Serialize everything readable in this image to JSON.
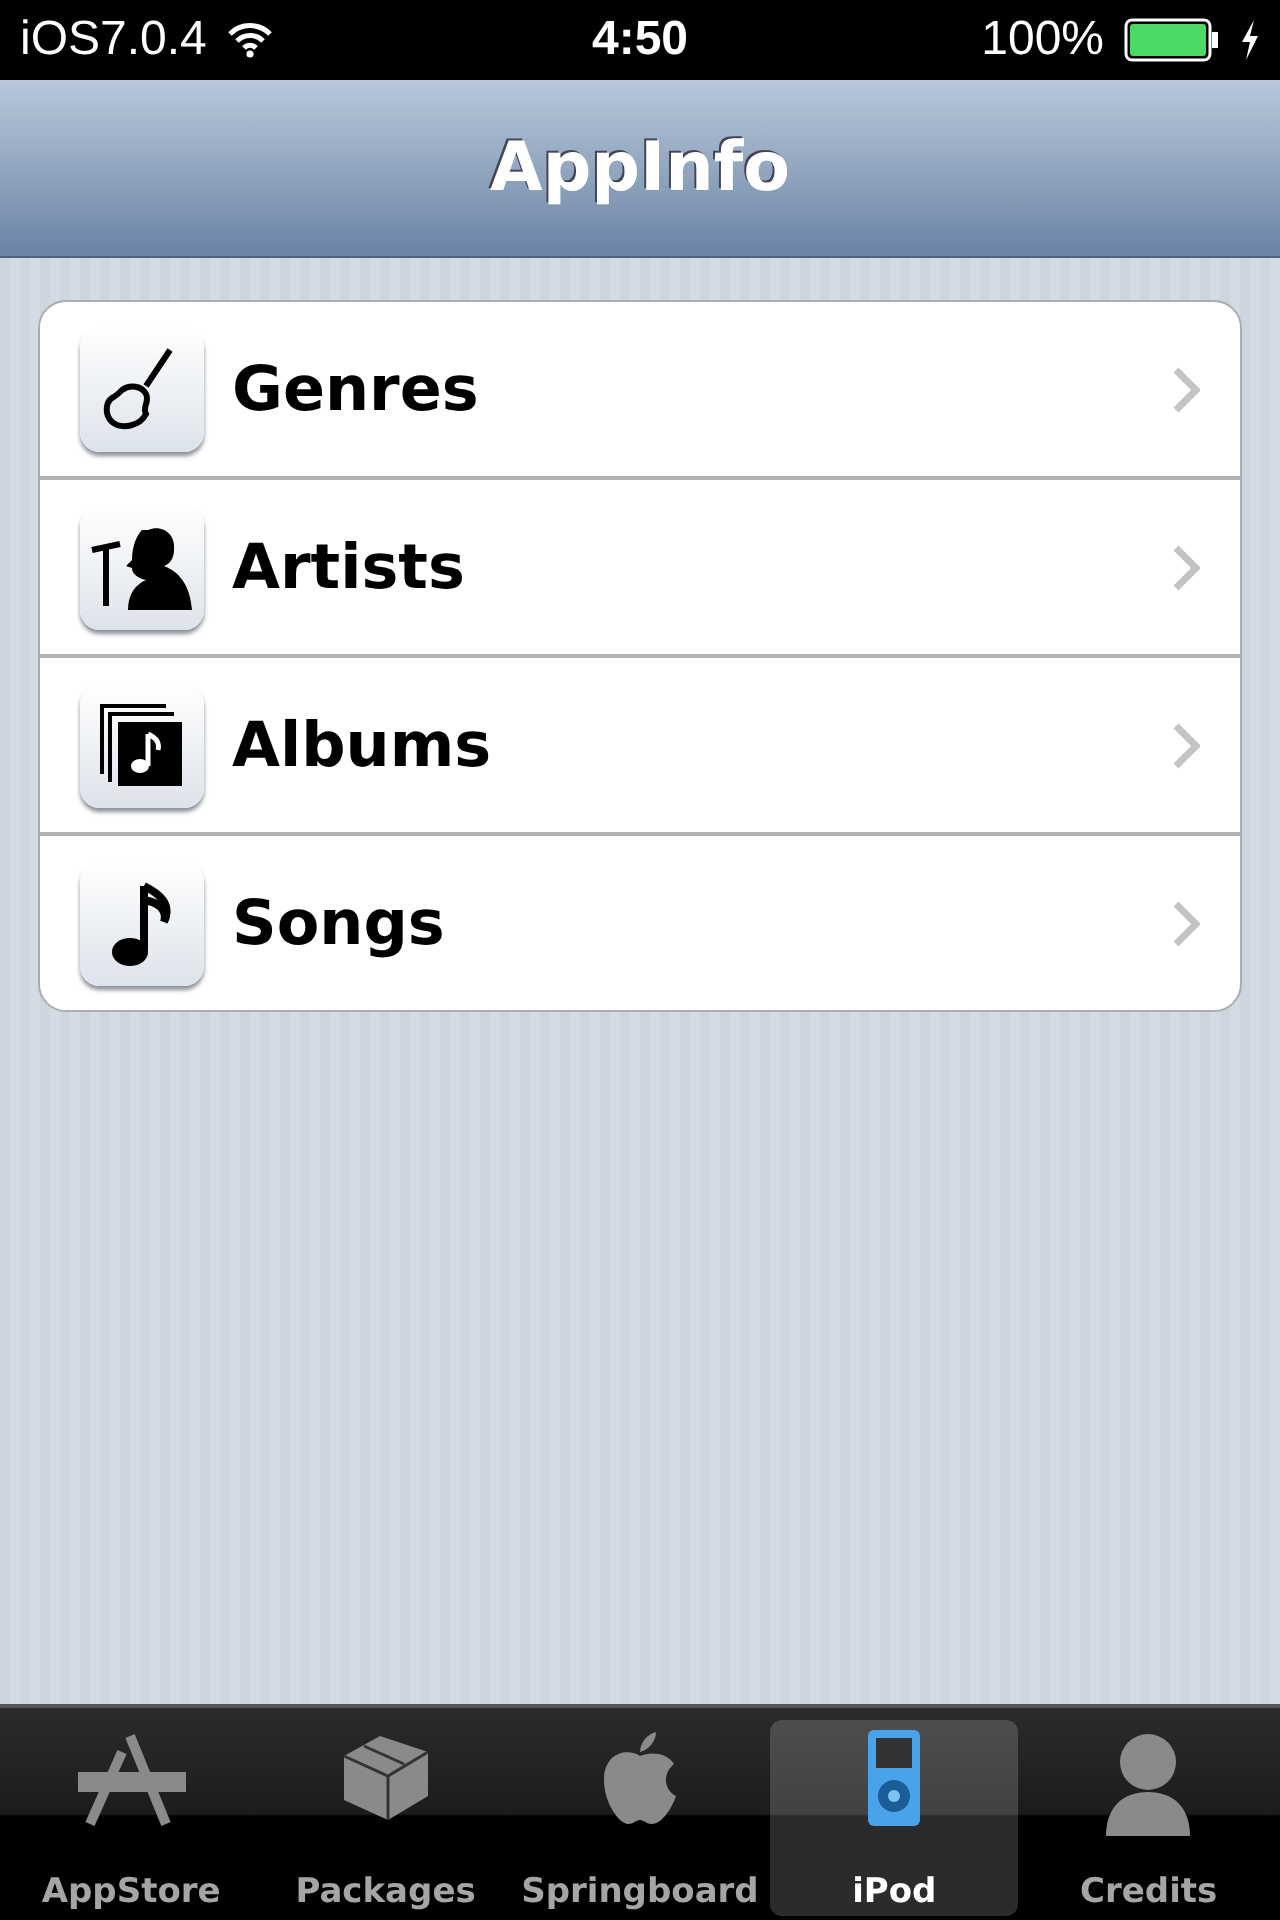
{
  "status_bar": {
    "carrier": "iOS7.0.4",
    "time": "4:50",
    "battery": "100%",
    "charging": true
  },
  "nav_bar": {
    "title": "AppInfo"
  },
  "list": [
    {
      "label": "Genres"
    },
    {
      "label": "Artists"
    },
    {
      "label": "Albums"
    },
    {
      "label": "Songs"
    }
  ],
  "tab_bar": [
    {
      "label": "AppStore",
      "selected": false
    },
    {
      "label": "Packages",
      "selected": false
    },
    {
      "label": "Springboard",
      "selected": false
    },
    {
      "label": "iPod",
      "selected": true
    },
    {
      "label": "Credits",
      "selected": false
    }
  ]
}
